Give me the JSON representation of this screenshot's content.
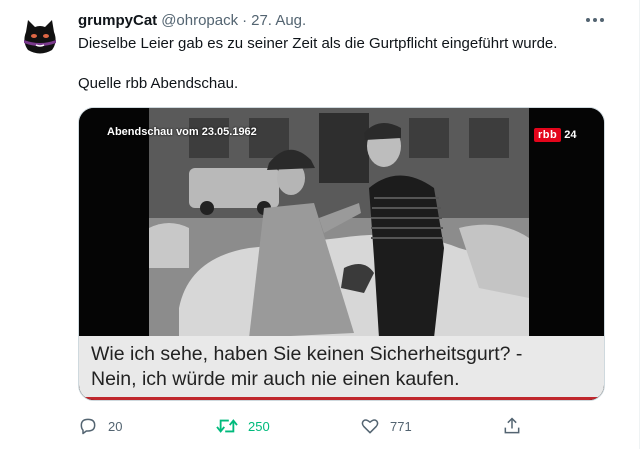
{
  "tweet": {
    "display_name": "grumpyCat",
    "handle": "@ohropack",
    "separator": "·",
    "time": "27. Aug.",
    "text_line1": "Dieselbe Leier gab es zu seiner Zeit als die Gurtpflicht eingeführt wurde.",
    "text_line2": "Quelle rbb Abendschau."
  },
  "media": {
    "overlay_title": "Abendschau vom 23.05.1962",
    "channel_logo": "rbb",
    "channel_number": "24",
    "subtitle_line1": "Wie ich sehe, haben Sie keinen Sicherheitsgurt? -",
    "subtitle_line2": "Nein, ich würde mir auch nie einen kaufen."
  },
  "actions": {
    "reply_count": "20",
    "retweet_count": "250",
    "like_count": "771"
  },
  "colors": {
    "accent_retweet": "#00ba7c",
    "muted": "#536471",
    "rbb_red": "#e3051b"
  },
  "icons": {
    "more": "more-dots-icon",
    "reply": "reply-icon",
    "retweet": "retweet-icon",
    "like": "heart-icon",
    "share": "share-icon"
  }
}
